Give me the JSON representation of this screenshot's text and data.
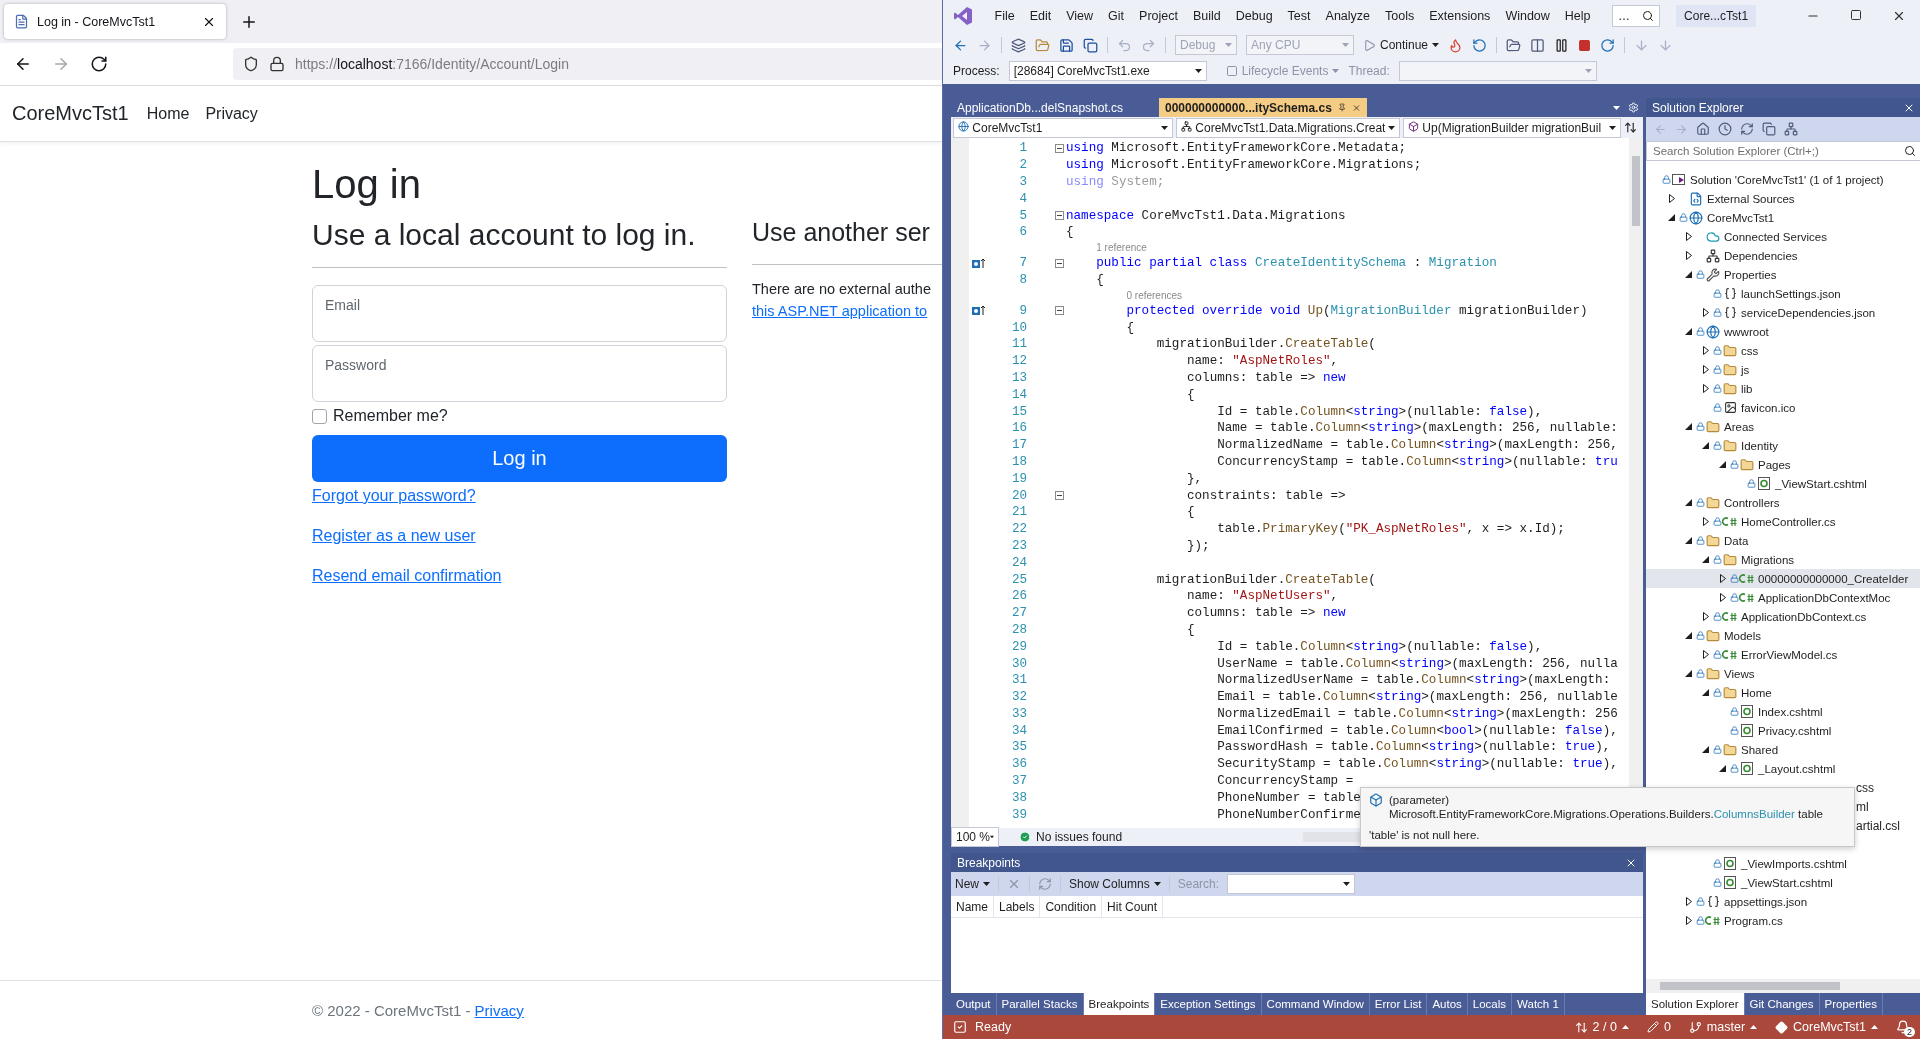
{
  "browser": {
    "tab": {
      "title": "Log in - CoreMvcTst1"
    },
    "url": {
      "scheme": "https://",
      "host": "localhost",
      "path": ":7166/Identity/Account/Login"
    },
    "site": {
      "brand": "CoreMvcTst1",
      "nav": [
        {
          "label": "Home"
        },
        {
          "label": "Privacy"
        }
      ]
    },
    "login": {
      "title": "Log in",
      "subtitle": "Use a local account to log in.",
      "email": {
        "placeholder": "Email"
      },
      "password": {
        "placeholder": "Password"
      },
      "remember": {
        "label": "Remember me?",
        "checked": false
      },
      "submit": "Log in",
      "links": [
        "Forgot your password?",
        "Register as a new user",
        "Resend email confirmation"
      ]
    },
    "external": {
      "title": "Use another ser",
      "text": "There are no external authe",
      "link": "this ASP.NET application to"
    },
    "footer": {
      "text": "© 2022 - CoreMvcTst1 - ",
      "link": "Privacy"
    }
  },
  "vs": {
    "menu": [
      "File",
      "Edit",
      "View",
      "Git",
      "Project",
      "Build",
      "Debug",
      "Test",
      "Analyze",
      "Tools",
      "Extensions",
      "Window",
      "Help"
    ],
    "search": "…",
    "title": "Core...cTst1",
    "toolbar": {
      "configuration": "Debug",
      "platform": "Any CPU",
      "continue": "Continue"
    },
    "debug_location": {
      "process_label": "Process:",
      "process": "[28684] CoreMvcTst1.exe",
      "lifecycle": "Lifecycle Events",
      "thread_label": "Thread:"
    },
    "documents": [
      {
        "title": "ApplicationDb...delSnapshot.cs",
        "selected": false
      },
      {
        "title": "000000000000...itySchema.cs",
        "selected": true
      }
    ],
    "navigation": [
      "CoreMvcTst1",
      "CoreMvcTst1.Data.Migrations.Creat",
      "Up(MigrationBuilder migrationBuil"
    ],
    "code": [
      {
        "number": "1",
        "fold": true,
        "marker": false,
        "tokens": [
          {
            "kind": "kw",
            "text": "using"
          },
          {
            "kind": "text",
            "text": " Microsoft.EntityFrameworkCore.Metadata;"
          }
        ]
      },
      {
        "number": "2",
        "fold": false,
        "marker": false,
        "tokens": [
          {
            "kind": "kw",
            "text": "using"
          },
          {
            "kind": "text",
            "text": " Microsoft.EntityFrameworkCore.Migrations;"
          }
        ]
      },
      {
        "number": "3",
        "fold": false,
        "marker": false,
        "tokens": [
          {
            "kind": "dimkw",
            "text": "using"
          },
          {
            "kind": "dim",
            "text": " System;"
          }
        ]
      },
      {
        "number": "4",
        "fold": false,
        "marker": false
      },
      {
        "number": "5",
        "fold": true,
        "marker": false,
        "tokens": [
          {
            "kind": "kw",
            "text": "namespace"
          },
          {
            "kind": "text",
            "text": " CoreMvcTst1.Data.Migrations"
          }
        ]
      },
      {
        "number": "6",
        "fold": false,
        "marker": false,
        "tokens": [
          {
            "kind": "text",
            "text": "{"
          }
        ]
      },
      {
        "kind": "lens",
        "text": "1 reference"
      },
      {
        "number": "7",
        "fold": true,
        "marker": true,
        "tokens": [
          {
            "kind": "kw",
            "text": "    public partial class "
          },
          {
            "kind": "type",
            "text": "CreateIdentitySchema"
          },
          {
            "kind": "text",
            "text": " : "
          },
          {
            "kind": "type",
            "text": "Migration"
          }
        ]
      },
      {
        "number": "8",
        "fold": false,
        "marker": false,
        "tokens": [
          {
            "kind": "text",
            "text": "    {"
          }
        ]
      },
      {
        "kind": "lens",
        "text": "0 references"
      },
      {
        "number": "9",
        "fold": true,
        "marker": true,
        "tokens": [
          {
            "kind": "kw",
            "text": "        protected override void "
          },
          {
            "kind": "method",
            "text": "Up"
          },
          {
            "kind": "text",
            "text": "("
          },
          {
            "kind": "type",
            "text": "MigrationBuilder"
          },
          {
            "kind": "text",
            "text": " migrationBuilder)"
          }
        ]
      },
      {
        "number": "10",
        "fold": false,
        "marker": false,
        "tokens": [
          {
            "kind": "text",
            "text": "        {"
          }
        ]
      },
      {
        "number": "11",
        "fold": false,
        "marker": false,
        "tokens": [
          {
            "kind": "text",
            "text": "            migrationBuilder."
          },
          {
            "kind": "method",
            "text": "CreateTable"
          },
          {
            "kind": "text",
            "text": "("
          }
        ]
      },
      {
        "number": "12",
        "fold": false,
        "marker": false,
        "tokens": [
          {
            "kind": "text",
            "text": "                name: "
          },
          {
            "kind": "str",
            "text": "\"AspNetRoles\""
          },
          {
            "kind": "text",
            "text": ","
          }
        ]
      },
      {
        "number": "13",
        "fold": false,
        "marker": false,
        "tokens": [
          {
            "kind": "text",
            "text": "                columns: table => "
          },
          {
            "kind": "kw",
            "text": "new"
          }
        ]
      },
      {
        "number": "14",
        "fold": false,
        "marker": false,
        "tokens": [
          {
            "kind": "text",
            "text": "                {"
          }
        ]
      },
      {
        "number": "15",
        "fold": false,
        "marker": false,
        "tokens": [
          {
            "kind": "text",
            "text": "                    Id = table."
          },
          {
            "kind": "method",
            "text": "Column"
          },
          {
            "kind": "text",
            "text": "<"
          },
          {
            "kind": "kw",
            "text": "string"
          },
          {
            "kind": "text",
            "text": ">(nullable: "
          },
          {
            "kind": "kw",
            "text": "false"
          },
          {
            "kind": "text",
            "text": "),"
          }
        ]
      },
      {
        "number": "16",
        "fold": false,
        "marker": false,
        "tokens": [
          {
            "kind": "text",
            "text": "                    Name = table."
          },
          {
            "kind": "method",
            "text": "Column"
          },
          {
            "kind": "text",
            "text": "<"
          },
          {
            "kind": "kw",
            "text": "string"
          },
          {
            "kind": "text",
            "text": ">(maxLength: 256, nullable:"
          }
        ]
      },
      {
        "number": "17",
        "fold": false,
        "marker": false,
        "tokens": [
          {
            "kind": "text",
            "text": "                    NormalizedName = table."
          },
          {
            "kind": "method",
            "text": "Column"
          },
          {
            "kind": "text",
            "text": "<"
          },
          {
            "kind": "kw",
            "text": "string"
          },
          {
            "kind": "text",
            "text": ">(maxLength: 256,"
          }
        ]
      },
      {
        "number": "18",
        "fold": false,
        "marker": false,
        "tokens": [
          {
            "kind": "text",
            "text": "                    ConcurrencyStamp = table."
          },
          {
            "kind": "method",
            "text": "Column"
          },
          {
            "kind": "text",
            "text": "<"
          },
          {
            "kind": "kw",
            "text": "string"
          },
          {
            "kind": "text",
            "text": ">(nullable: "
          },
          {
            "kind": "kw",
            "text": "tru"
          }
        ]
      },
      {
        "number": "19",
        "fold": false,
        "marker": false,
        "tokens": [
          {
            "kind": "text",
            "text": "                },"
          }
        ]
      },
      {
        "number": "20",
        "fold": true,
        "marker": false,
        "tokens": [
          {
            "kind": "text",
            "text": "                constraints: table =>"
          }
        ]
      },
      {
        "number": "21",
        "fold": false,
        "marker": false,
        "tokens": [
          {
            "kind": "text",
            "text": "                {"
          }
        ]
      },
      {
        "number": "22",
        "fold": false,
        "marker": false,
        "tokens": [
          {
            "kind": "text",
            "text": "                    table."
          },
          {
            "kind": "method",
            "text": "PrimaryKey"
          },
          {
            "kind": "text",
            "text": "("
          },
          {
            "kind": "str",
            "text": "\"PK_AspNetRoles\""
          },
          {
            "kind": "text",
            "text": ", x => x.Id);"
          }
        ]
      },
      {
        "number": "23",
        "fold": false,
        "marker": false,
        "tokens": [
          {
            "kind": "text",
            "text": "                });"
          }
        ]
      },
      {
        "number": "24",
        "fold": false,
        "marker": false
      },
      {
        "number": "25",
        "fold": false,
        "marker": false,
        "tokens": [
          {
            "kind": "text",
            "text": "            migrationBuilder."
          },
          {
            "kind": "method",
            "text": "CreateTable"
          },
          {
            "kind": "text",
            "text": "("
          }
        ]
      },
      {
        "number": "26",
        "fold": false,
        "marker": false,
        "tokens": [
          {
            "kind": "text",
            "text": "                name: "
          },
          {
            "kind": "str",
            "text": "\"AspNetUsers\""
          },
          {
            "kind": "text",
            "text": ","
          }
        ]
      },
      {
        "number": "27",
        "fold": false,
        "marker": false,
        "tokens": [
          {
            "kind": "text",
            "text": "                columns: table => "
          },
          {
            "kind": "kw",
            "text": "new"
          }
        ]
      },
      {
        "number": "28",
        "fold": false,
        "marker": false,
        "tokens": [
          {
            "kind": "text",
            "text": "                {"
          }
        ]
      },
      {
        "number": "29",
        "fold": false,
        "marker": false,
        "tokens": [
          {
            "kind": "text",
            "text": "                    Id = table."
          },
          {
            "kind": "method",
            "text": "Column"
          },
          {
            "kind": "text",
            "text": "<"
          },
          {
            "kind": "kw",
            "text": "string"
          },
          {
            "kind": "text",
            "text": ">(nullable: "
          },
          {
            "kind": "kw",
            "text": "false"
          },
          {
            "kind": "text",
            "text": "),"
          }
        ]
      },
      {
        "number": "30",
        "fold": false,
        "marker": false,
        "tokens": [
          {
            "kind": "text",
            "text": "                    UserName = table."
          },
          {
            "kind": "method",
            "text": "Column"
          },
          {
            "kind": "text",
            "text": "<"
          },
          {
            "kind": "kw",
            "text": "string"
          },
          {
            "kind": "text",
            "text": ">(maxLength: 256, nulla"
          }
        ]
      },
      {
        "number": "31",
        "fold": false,
        "marker": false,
        "tokens": [
          {
            "kind": "text",
            "text": "                    NormalizedUserName = table."
          },
          {
            "kind": "method",
            "text": "Column"
          },
          {
            "kind": "text",
            "text": "<"
          },
          {
            "kind": "kw",
            "text": "string"
          },
          {
            "kind": "text",
            "text": ">(maxLength:"
          }
        ]
      },
      {
        "number": "32",
        "fold": false,
        "marker": false,
        "tokens": [
          {
            "kind": "text",
            "text": "                    Email = table."
          },
          {
            "kind": "method",
            "text": "Column"
          },
          {
            "kind": "text",
            "text": "<"
          },
          {
            "kind": "kw",
            "text": "string"
          },
          {
            "kind": "text",
            "text": ">(maxLength: 256, nullable"
          }
        ]
      },
      {
        "number": "33",
        "fold": false,
        "marker": false,
        "tokens": [
          {
            "kind": "text",
            "text": "                    NormalizedEmail = table."
          },
          {
            "kind": "method",
            "text": "Column"
          },
          {
            "kind": "text",
            "text": "<"
          },
          {
            "kind": "kw",
            "text": "string"
          },
          {
            "kind": "text",
            "text": ">(maxLength: 256"
          }
        ]
      },
      {
        "number": "34",
        "fold": false,
        "marker": false,
        "tokens": [
          {
            "kind": "text",
            "text": "                    EmailConfirmed = table."
          },
          {
            "kind": "method",
            "text": "Column"
          },
          {
            "kind": "text",
            "text": "<"
          },
          {
            "kind": "kw",
            "text": "bool"
          },
          {
            "kind": "text",
            "text": ">(nullable: "
          },
          {
            "kind": "kw",
            "text": "false"
          },
          {
            "kind": "text",
            "text": "),"
          }
        ]
      },
      {
        "number": "35",
        "fold": false,
        "marker": false,
        "tokens": [
          {
            "kind": "text",
            "text": "                    PasswordHash = table."
          },
          {
            "kind": "method",
            "text": "Column"
          },
          {
            "kind": "text",
            "text": "<"
          },
          {
            "kind": "kw",
            "text": "string"
          },
          {
            "kind": "text",
            "text": ">(nullable: "
          },
          {
            "kind": "kw",
            "text": "true"
          },
          {
            "kind": "text",
            "text": "),"
          }
        ]
      },
      {
        "number": "36",
        "fold": false,
        "marker": false,
        "tokens": [
          {
            "kind": "text",
            "text": "                    SecurityStamp = table."
          },
          {
            "kind": "method",
            "text": "Column"
          },
          {
            "kind": "text",
            "text": "<"
          },
          {
            "kind": "kw",
            "text": "string"
          },
          {
            "kind": "text",
            "text": ">(nullable: "
          },
          {
            "kind": "kw",
            "text": "true"
          },
          {
            "kind": "text",
            "text": "),"
          }
        ]
      },
      {
        "number": "37",
        "fold": false,
        "marker": false,
        "tokens": [
          {
            "kind": "text",
            "text": "                    ConcurrencyStamp ="
          }
        ]
      },
      {
        "number": "38",
        "fold": false,
        "marker": false,
        "tokens": [
          {
            "kind": "text",
            "text": "                    PhoneNumber = table"
          }
        ]
      },
      {
        "number": "39",
        "fold": false,
        "marker": false,
        "tokens": [
          {
            "kind": "text",
            "text": "                    PhoneNumberConfirme"
          }
        ]
      }
    ],
    "editor_status": {
      "zoom": "100 %",
      "issues": "No issues found"
    },
    "tooltip": {
      "heading": "(parameter)",
      "signature": [
        {
          "kind": "text",
          "text": "Microsoft.EntityFrameworkCore.Migrations.Operations.Builders."
        },
        {
          "kind": "type",
          "text": "ColumnsBuilder"
        },
        {
          "kind": "text",
          "text": " table"
        }
      ],
      "note": "'table' is not null here."
    },
    "breakpoints": {
      "title": "Breakpoints",
      "new": "New",
      "show_columns": "Show Columns",
      "search_label": "Search:",
      "columns": [
        "Name",
        "Labels",
        "Condition",
        "Hit Count"
      ]
    },
    "bottom_tabs": [
      {
        "label": "Output",
        "selected": false
      },
      {
        "label": "Parallel Stacks",
        "selected": false
      },
      {
        "label": "Breakpoints",
        "selected": true
      },
      {
        "label": "Exception Settings",
        "selected": false
      },
      {
        "label": "Command Window",
        "selected": false
      },
      {
        "label": "Error List",
        "selected": false
      },
      {
        "label": "Autos",
        "selected": false
      },
      {
        "label": "Locals",
        "selected": false
      },
      {
        "label": "Watch 1",
        "selected": false
      }
    ],
    "solution_explorer": {
      "title": "Solution Explorer",
      "search": {
        "placeholder": "Search Solution Explorer (Ctrl+;)"
      },
      "tree": [
        {
          "label": "Solution 'CoreMvcTst1' (1 of 1 project)",
          "kind": "solution",
          "locked": true,
          "selected": false,
          "children": [
            {
              "label": "External Sources",
              "kind": "external",
              "locked": false,
              "selected": false,
              "expanded": false
            },
            {
              "label": "CoreMvcTst1",
              "kind": "project",
              "locked": true,
              "selected": false,
              "expanded": true,
              "children": [
                {
                  "label": "Connected Services",
                  "kind": "connected",
                  "locked": false,
                  "selected": false,
                  "expanded": false
                },
                {
                  "label": "Dependencies",
                  "kind": "dependencies",
                  "locked": false,
                  "selected": false,
                  "expanded": false
                },
                {
                  "label": "Properties",
                  "kind": "properties",
                  "locked": true,
                  "selected": false,
                  "expanded": true,
                  "children": [
                    {
                      "label": "launchSettings.json",
                      "kind": "json",
                      "locked": true,
                      "selected": false
                    },
                    {
                      "label": "serviceDependencies.json",
                      "kind": "json",
                      "locked": true,
                      "selected": false,
                      "expanded": false
                    }
                  ]
                },
                {
                  "label": "wwwroot",
                  "kind": "web",
                  "locked": true,
                  "selected": false,
                  "expanded": true,
                  "children": [
                    {
                      "label": "css",
                      "kind": "folder",
                      "locked": true,
                      "selected": false,
                      "expanded": false
                    },
                    {
                      "label": "js",
                      "kind": "folder",
                      "locked": true,
                      "selected": false,
                      "expanded": false
                    },
                    {
                      "label": "lib",
                      "kind": "folder",
                      "locked": true,
                      "selected": false,
                      "expanded": false
                    },
                    {
                      "label": "favicon.ico",
                      "kind": "image",
                      "locked": true,
                      "selected": false
                    }
                  ]
                },
                {
                  "label": "Areas",
                  "kind": "folder",
                  "locked": true,
                  "selected": false,
                  "expanded": true,
                  "children": [
                    {
                      "label": "Identity",
                      "kind": "folder",
                      "locked": true,
                      "selected": false,
                      "expanded": true,
                      "children": [
                        {
                          "label": "Pages",
                          "kind": "folder",
                          "locked": true,
                          "selected": false,
                          "expanded": true,
                          "children": [
                            {
                              "label": "_ViewStart.cshtml",
                              "kind": "razor",
                              "locked": true,
                              "selected": false
                            }
                          ]
                        }
                      ]
                    }
                  ]
                },
                {
                  "label": "Controllers",
                  "kind": "folder",
                  "locked": true,
                  "selected": false,
                  "expanded": true,
                  "children": [
                    {
                      "label": "HomeController.cs",
                      "kind": "csharp",
                      "locked": true,
                      "selected": false,
                      "expanded": false
                    }
                  ]
                },
                {
                  "label": "Data",
                  "kind": "folder",
                  "locked": true,
                  "selected": false,
                  "expanded": true,
                  "children": [
                    {
                      "label": "Migrations",
                      "kind": "folder",
                      "locked": true,
                      "selected": false,
                      "expanded": true,
                      "children": [
                        {
                          "label": "00000000000000_CreateIder",
                          "kind": "csharp",
                          "locked": true,
                          "selected": true,
                          "expanded": false
                        },
                        {
                          "label": "ApplicationDbContextMoc",
                          "kind": "csharp",
                          "locked": true,
                          "selected": false,
                          "expanded": false
                        }
                      ]
                    },
                    {
                      "label": "ApplicationDbContext.cs",
                      "kind": "csharp",
                      "locked": true,
                      "selected": false,
                      "expanded": false
                    }
                  ]
                },
                {
                  "label": "Models",
                  "kind": "folder",
                  "locked": true,
                  "selected": false,
                  "expanded": true,
                  "children": [
                    {
                      "label": "ErrorViewModel.cs",
                      "kind": "csharp",
                      "locked": true,
                      "selected": false,
                      "expanded": false
                    }
                  ]
                },
                {
                  "label": "Views",
                  "kind": "folder",
                  "locked": true,
                  "selected": false,
                  "expanded": true,
                  "children": [
                    {
                      "label": "Home",
                      "kind": "folder",
                      "locked": true,
                      "selected": false,
                      "expanded": true,
                      "children": [
                        {
                          "label": "Index.cshtml",
                          "kind": "razor",
                          "locked": true,
                          "selected": false
                        },
                        {
                          "label": "Privacy.cshtml",
                          "kind": "razor",
                          "locked": true,
                          "selected": false
                        }
                      ]
                    },
                    {
                      "label": "Shared",
                      "kind": "folder",
                      "locked": true,
                      "selected": false,
                      "expanded": true,
                      "children": [
                        {
                          "label": "_Layout.cshtml",
                          "kind": "razor",
                          "locked": true,
                          "selected": false,
                          "expanded": true,
                          "children": [
                            {
                              "label": "css",
                              "kind": "clipped"
                            }
                          ]
                        },
                        {
                          "label": "ml",
                          "kind": "clipped"
                        },
                        {
                          "label": "artial.csl",
                          "kind": "clipped"
                        }
                      ]
                    },
                    {
                      "label": "_ViewImports.cshtml",
                      "kind": "razor",
                      "locked": true,
                      "selected": false
                    },
                    {
                      "label": "_ViewStart.cshtml",
                      "kind": "razor",
                      "locked": true,
                      "selected": false
                    }
                  ]
                },
                {
                  "label": "appsettings.json",
                  "kind": "json",
                  "locked": true,
                  "selected": false,
                  "expanded": false
                },
                {
                  "label": "Program.cs",
                  "kind": "csharp",
                  "locked": true,
                  "selected": false,
                  "expanded": false
                }
              ]
            }
          ]
        }
      ],
      "tabs": [
        {
          "label": "Solution Explorer",
          "selected": true
        },
        {
          "label": "Git Changes",
          "selected": false
        },
        {
          "label": "Properties",
          "selected": false
        }
      ]
    },
    "status_bar": {
      "state": "Ready",
      "changes": "2 / 0",
      "edits": "0",
      "branch": "master",
      "repo": "CoreMvcTst1",
      "notifications": "2"
    }
  }
}
